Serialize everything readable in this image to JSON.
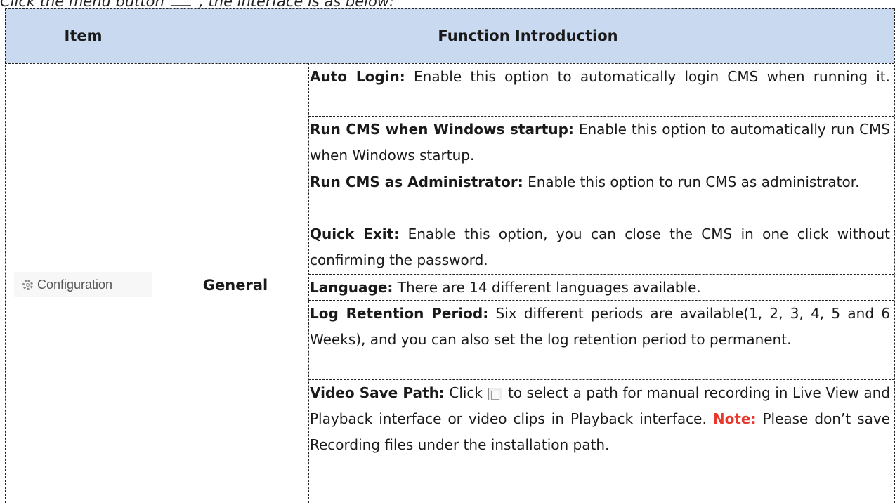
{
  "caption": {
    "before": "Click the menu button",
    "after": ", the interface is as below:"
  },
  "table": {
    "headers": {
      "item": "Item",
      "function": "Function Introduction"
    },
    "item_button": "Configuration",
    "category": "General",
    "rows": [
      {
        "label": "Auto Login:",
        "text": " Enable this option to automatically login CMS when running it."
      },
      {
        "label": "Run CMS when Windows startup:",
        "text": " Enable this option to automatically run CMS when Windows startup."
      },
      {
        "label": "Run CMS as Administrator:",
        "text": " Enable this option to run CMS as administrator."
      },
      {
        "label": "Quick Exit:",
        "text": " Enable this option, you can close the CMS in one click without confirming the password."
      },
      {
        "label": "Language:",
        "text": " There are 14 different languages available."
      },
      {
        "label": "Log Retention Period:",
        "text": " Six different periods are available(1, 2, 3, 4, 5 and 6 Weeks), and you can also set the log retention period to permanent."
      },
      {
        "label": "Video Save Path:",
        "text_before": " Click",
        "text_after": "to select a path for manual recording in Live View and Playback interface or video clips in Playback interface.",
        "icon": "folder-icon",
        "note_label": "Note:",
        "note_text": " Please don’t save Recording files under the installation path."
      }
    ]
  }
}
